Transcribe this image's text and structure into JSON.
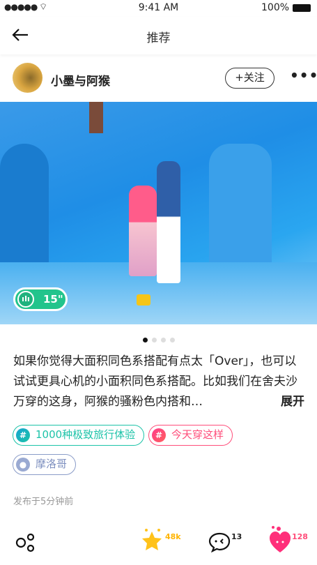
{
  "status": {
    "time": "9:41 AM",
    "battery": "100%"
  },
  "nav": {
    "title": "推荐"
  },
  "author": {
    "name": "小墨与阿猴",
    "follow_label": "+关注"
  },
  "photo": {
    "voice_duration": "15\"",
    "page_count": 4,
    "current_page": 1
  },
  "post": {
    "text": "如果你觉得大面积同色系搭配有点太「Over」，也可以试试更具心机的小面积同色系搭配。比如我们在舍夫沙万穿的这身，阿猴的骚粉色内搭和…",
    "expand_label": "展开"
  },
  "tags": [
    {
      "label": "1000种极致旅行体验",
      "color": "#1cc3a8"
    },
    {
      "label": "今天穿这样",
      "color": "#ff4d7a"
    }
  ],
  "location": {
    "label": "摩洛哥",
    "color": "#8a9cc8"
  },
  "published": "发布于5分钟前",
  "actions": {
    "favorites": "48k",
    "comments": "13",
    "likes": "128"
  }
}
